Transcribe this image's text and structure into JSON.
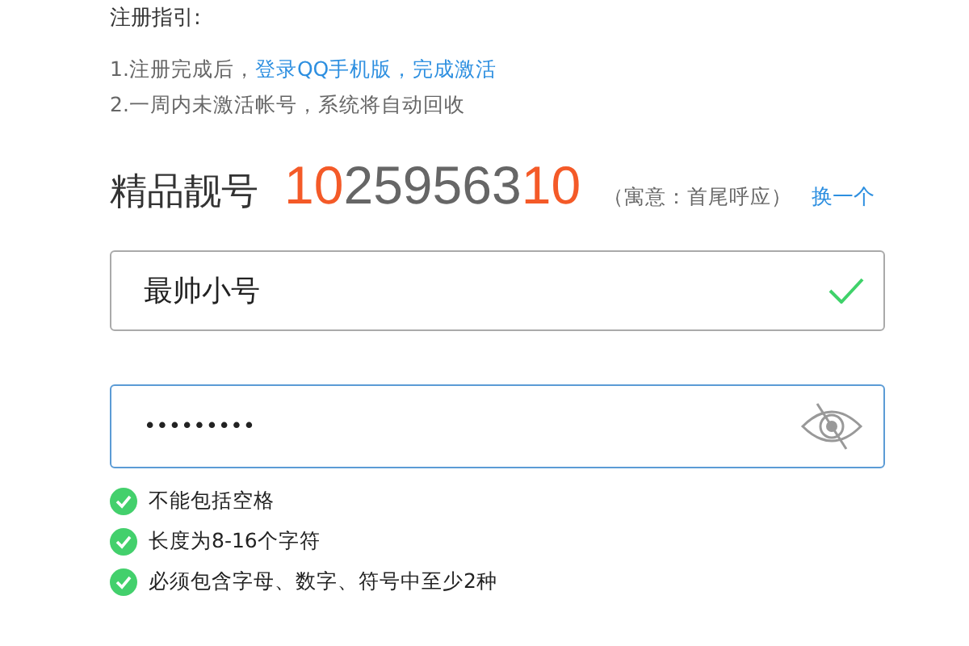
{
  "guide": {
    "title": "注册指引:",
    "steps": [
      {
        "text": "1.注册完成后，",
        "link": "登录QQ手机版，完成激活"
      },
      {
        "text": "2.一周内未激活帐号，系统将自动回收"
      }
    ]
  },
  "account": {
    "label": "精品靓号",
    "number": [
      {
        "text": "10",
        "highlight": true
      },
      {
        "text": "259563",
        "highlight": false
      },
      {
        "text": "10",
        "highlight": true
      }
    ],
    "meaning": "（寓意：首尾呼应）",
    "change": "换一个"
  },
  "nickname": {
    "value": "最帅小号",
    "valid": true,
    "focused": false
  },
  "password": {
    "value": "•••••••••",
    "focused": true,
    "visible": false
  },
  "rules": [
    {
      "text": "不能包括空格",
      "met": true
    },
    {
      "text": "长度为8-16个字符",
      "met": true
    },
    {
      "text": "必须包含字母、数字、符号中至少2种",
      "met": true
    }
  ]
}
